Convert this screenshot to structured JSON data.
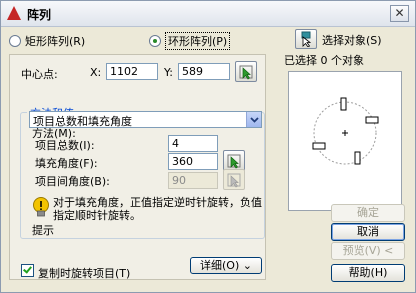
{
  "window": {
    "title": "阵列",
    "close_glyph": "✕"
  },
  "array_type": {
    "rectangular_label": "矩形阵列(R)",
    "polar_label": "环形阵列(P)",
    "selected": "polar"
  },
  "select_objects": {
    "button_label": "选择对象(S)",
    "status_label": "已选择 0 个对象"
  },
  "center_point": {
    "label": "中心点:",
    "x_label": "X:",
    "x_value": "1102",
    "y_label": "Y:",
    "y_value": "589"
  },
  "method_group": {
    "title": "方法和值",
    "method_label": "方法(M):",
    "method_value": "项目总数和填充角度",
    "total_items_label": "项目总数(I):",
    "total_items_value": "4",
    "fill_angle_label": "填充角度(F):",
    "fill_angle_value": "360",
    "angle_between_label": "项目间角度(B):",
    "angle_between_value": "90"
  },
  "hint": {
    "text": "对于填充角度，正值指定逆时针旋转，负值指定顺时针旋转。",
    "caption": "提示"
  },
  "rotate_items": {
    "label": "复制时旋转项目(T)",
    "checked": true
  },
  "details_button": "详细(O)  ⌄",
  "buttons": {
    "ok": "确定",
    "cancel": "取消",
    "preview": "预览(V)  <",
    "help": "帮助(H)"
  },
  "colors": {
    "group_title": "#0046d5",
    "hint_bulb": "#f2c300",
    "radio_dot": "#2a8a2a",
    "check_tick": "#21a121",
    "pick_arrow": "#2d9a2d",
    "preview_rect": "#c9302c"
  }
}
